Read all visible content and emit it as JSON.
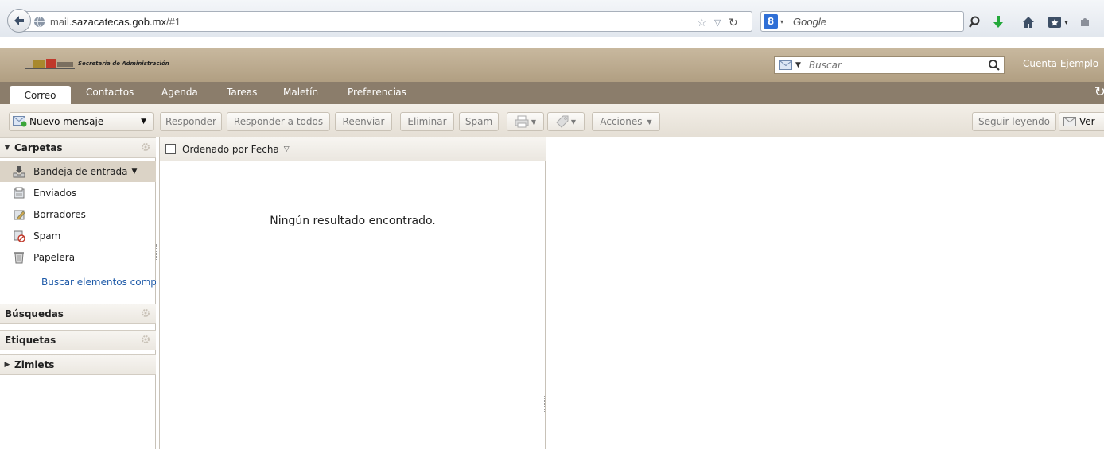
{
  "browser": {
    "url_prefix": "mail.",
    "url_domain": "sazacatecas.gob.mx",
    "url_suffix": "/#1",
    "search_engine_label": "Google"
  },
  "header": {
    "org_name": "Secretaría de Administración",
    "search_placeholder": "Buscar",
    "account_name": "Cuenta Ejemplo"
  },
  "tabs": [
    "Correo",
    "Contactos",
    "Agenda",
    "Tareas",
    "Maletín",
    "Preferencias"
  ],
  "toolbar": {
    "new_message": "Nuevo mensaje",
    "reply": "Responder",
    "reply_all": "Responder a todos",
    "forward": "Reenviar",
    "delete": "Eliminar",
    "spam": "Spam",
    "actions": "Acciones",
    "keep_reading": "Seguir leyendo",
    "view": "Ver"
  },
  "sidebar": {
    "folders_header": "Carpetas",
    "folders": [
      {
        "label": "Bandeja de entrada",
        "icon": "inbox-icon"
      },
      {
        "label": "Enviados",
        "icon": "sent-icon"
      },
      {
        "label": "Borradores",
        "icon": "drafts-icon"
      },
      {
        "label": "Spam",
        "icon": "spam-icon"
      },
      {
        "label": "Papelera",
        "icon": "trash-icon"
      }
    ],
    "search_shared": "Buscar elementos compa",
    "searches_header": "Búsquedas",
    "tags_header": "Etiquetas",
    "zimlets_header": "Zimlets"
  },
  "message_list": {
    "sort_label": "Ordenado por Fecha",
    "empty_text": "Ningún resultado encontrado."
  },
  "colors": {
    "header_bg": "#b8a78b",
    "tabs_bg": "#8b7d6b",
    "link": "#1e5aa8"
  }
}
